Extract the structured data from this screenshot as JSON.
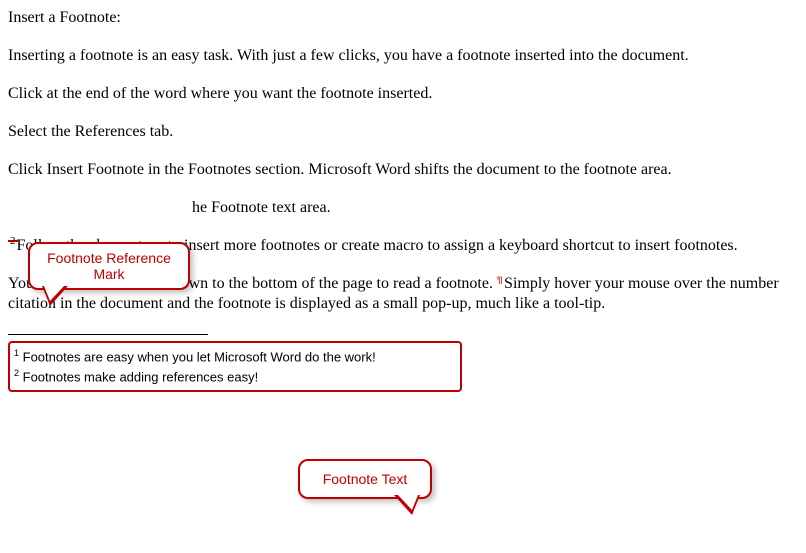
{
  "paragraphs": {
    "p1": "Insert a Footnote:",
    "p2": "Inserting a footnote is an easy task. With just a few clicks, you have a footnote inserted into the document.",
    "p3": "Click at the end of the word where you want the footnote inserted.",
    "p4": "Select the References tab.",
    "p5": "Click Insert Footnote in the Footnotes section. Microsoft Word shifts the document to the footnote area.",
    "p6_after": "he Footnote text area.",
    "p7_ref": "2",
    "p7_rest": "Follow the above steps to insert more footnotes or create macro to assign a keyboard shortcut to insert footnotes.",
    "p8_a": "You do not have to scroll down to the bottom of the page to read a footnote. ",
    "p8_b": "Simply hover your mouse over the number citation in the document and the footnote is displayed as a small pop-up, much like a tool-tip."
  },
  "callouts": {
    "ref_mark_l1": "Footnote Reference",
    "ref_mark_l2": "Mark",
    "ftn_text": "Footnote Text"
  },
  "footnotes": {
    "f1_num": "1",
    "f1_text": " Footnotes are easy when you let Microsoft Word do the work!",
    "f2_num": "2",
    "f2_text": " Footnotes make adding references easy!"
  }
}
